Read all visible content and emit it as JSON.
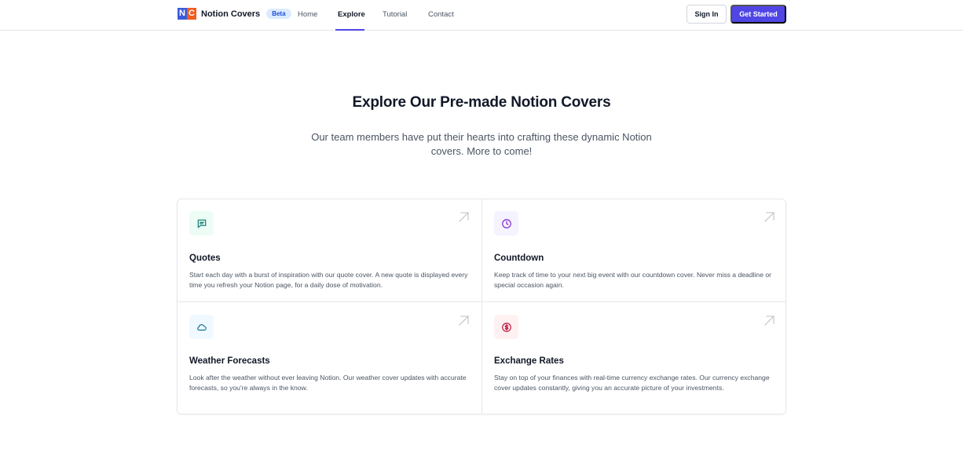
{
  "nav": {
    "brand": {
      "logo_letters": [
        "N",
        "C"
      ],
      "name": "Notion Covers",
      "badge": "Beta"
    },
    "links": [
      {
        "label": "Home"
      },
      {
        "label": "Explore",
        "active": true
      },
      {
        "label": "Tutorial"
      },
      {
        "label": "Contact"
      }
    ],
    "sign_in": "Sign In",
    "get_started": "Get Started"
  },
  "hero": {
    "title": "Explore Our Pre-made Notion Covers",
    "subtitle": "Our team members have put their hearts into crafting these dynamic Notion covers. More to come!"
  },
  "cards": [
    {
      "title": "Quotes",
      "icon": "chat-bubble-icon",
      "description": "Start each day with a burst of inspiration with our quote cover. A new quote is displayed every time you refresh your Notion page, for a daily dose of motivation."
    },
    {
      "title": "Countdown",
      "icon": "clock-icon",
      "description": "Keep track of time to your next big event with our countdown cover. Never miss a deadline or special occasion again."
    },
    {
      "title": "Weather Forecasts",
      "icon": "cloud-icon",
      "description": "Look after the weather without ever leaving Notion. Our weather cover updates with accurate forecasts, so you're always in the know."
    },
    {
      "title": "Exchange Rates",
      "icon": "dollar-circle-icon",
      "description": "Stay on top of your finances with real-time currency exchange rates. Our currency exchange cover updates constantly, giving you an accurate picture of your investments."
    }
  ],
  "colors": {
    "accent": "#4f46e5",
    "logo_blue": "#3b5bdb",
    "logo_orange": "#f25c1f",
    "quotes_icon_bg": "#ecfdf5",
    "quotes_icon": "#0f766e",
    "countdown_icon_bg": "#f5f3ff",
    "countdown_icon": "#7e22ce",
    "weather_icon_bg": "#f0f9ff",
    "weather_icon": "#0e7490",
    "exchange_icon_bg": "#fff1f2",
    "exchange_icon": "#be123c"
  }
}
